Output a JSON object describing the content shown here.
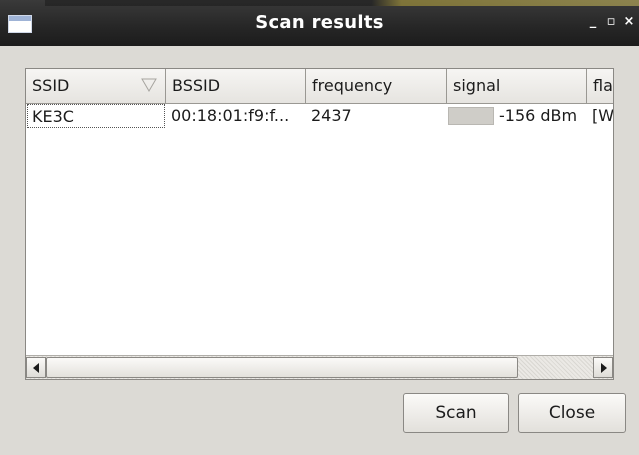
{
  "window": {
    "title": "Scan results",
    "controls": {
      "minimize": "_",
      "maximize": "▫",
      "close": "×"
    }
  },
  "table": {
    "columns": [
      {
        "key": "ssid",
        "label": "SSID",
        "sorted": true
      },
      {
        "key": "bssid",
        "label": "BSSID"
      },
      {
        "key": "frequency",
        "label": "frequency"
      },
      {
        "key": "signal",
        "label": "signal"
      },
      {
        "key": "flags",
        "label": "flag"
      }
    ],
    "rows": [
      {
        "ssid": "KE3C",
        "bssid": "00:18:01:f9:f...",
        "frequency": "2437",
        "signal": "-156 dBm",
        "flags": "[WE"
      }
    ]
  },
  "buttons": {
    "scan": "Scan",
    "close": "Close"
  },
  "colors": {
    "titlebar": "#262626",
    "window_bg": "#dcdad5",
    "list_bg": "#ffffff"
  }
}
